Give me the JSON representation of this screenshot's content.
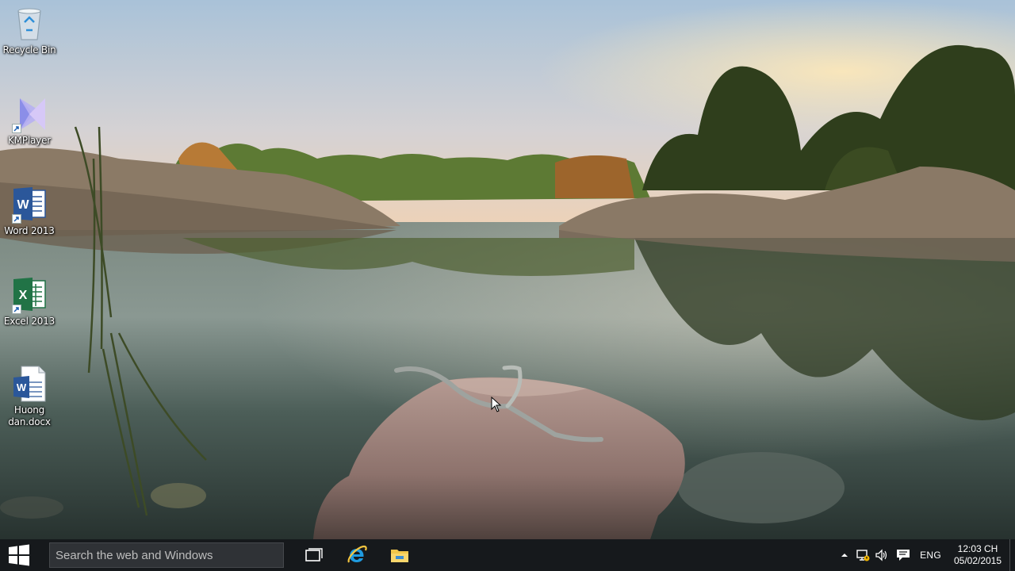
{
  "desktop": {
    "icons": [
      {
        "label": "Recycle Bin",
        "icon": "recycle-bin-icon"
      },
      {
        "label": "KMPlayer",
        "icon": "kmplayer-icon"
      },
      {
        "label": "Word 2013",
        "icon": "word-icon"
      },
      {
        "label": "Excel 2013",
        "icon": "excel-icon"
      },
      {
        "label": "Huong dan.docx",
        "icon": "word-document-icon"
      }
    ]
  },
  "taskbar": {
    "search_placeholder": "Search the web and Windows",
    "pinned": [
      {
        "name": "Task View",
        "icon": "task-view-icon"
      },
      {
        "name": "Internet Explorer",
        "icon": "internet-explorer-icon"
      },
      {
        "name": "File Explorer",
        "icon": "file-explorer-icon"
      }
    ],
    "tray": {
      "language": "ENG",
      "time": "12:03 CH",
      "date": "05/02/2015"
    }
  },
  "colors": {
    "taskbar_bg": "#16191c",
    "search_bg": "#2f3236",
    "word_blue": "#2b579a",
    "excel_green": "#217346",
    "ie_blue": "#1f9be0",
    "folder_yellow": "#f2c74a"
  }
}
